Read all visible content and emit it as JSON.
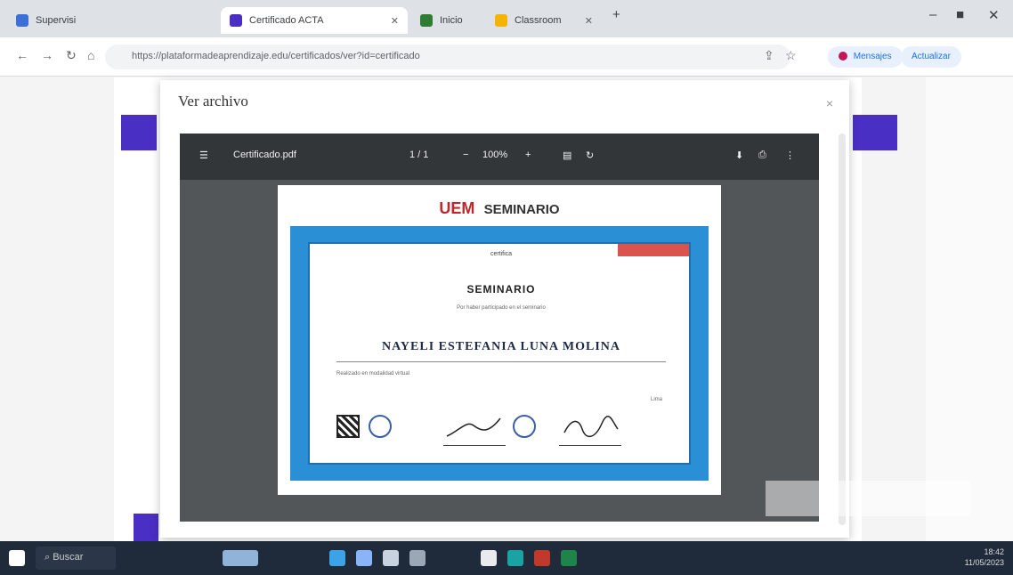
{
  "browser": {
    "tabs": [
      {
        "label": "Supervisi",
        "active": false,
        "favicon_color": "#3d6fd8"
      },
      {
        "label": "Certificado ACTA",
        "active": true,
        "favicon_color": "#4a2fc4"
      },
      {
        "label": "Inicio",
        "active": false,
        "favicon_color": "#2f7d32"
      },
      {
        "label": "Classroom",
        "active": false,
        "favicon_color": "#f4b400"
      }
    ],
    "address": "https://plataformadeaprendizaje.edu/certificados/ver?id=certificado",
    "profile_pill": "Mensajes",
    "update_pill": "Actualizar"
  },
  "modal": {
    "title": "Ver archivo",
    "close_symbol": "×"
  },
  "pdf_viewer": {
    "file_name": "Certificado.pdf",
    "page": "1 / 1",
    "zoom": "100%"
  },
  "certificate": {
    "header_logo": "UEM",
    "header_text": "SEMINARIO",
    "top_caption": "certifica",
    "title": "SEMINARIO",
    "subtitle": "Por haber participado en el seminario",
    "recipient": "NAYELI ESTEFANIA LUNA MOLINA",
    "description": "Realizado en modalidad virtual",
    "date": "Lima"
  },
  "taskbar": {
    "search_label": "Buscar",
    "time": "18:42",
    "date": "11/05/2023",
    "icons": [
      "explorer-icon",
      "edge-icon",
      "mail-icon",
      "store-icon",
      "chrome-icon",
      "teams-icon",
      "word-icon",
      "excel-icon"
    ]
  },
  "colors": {
    "brand_purple": "#4a2fc4",
    "certificate_blue": "#2b8fd6",
    "viewer_gray": "#525659"
  }
}
